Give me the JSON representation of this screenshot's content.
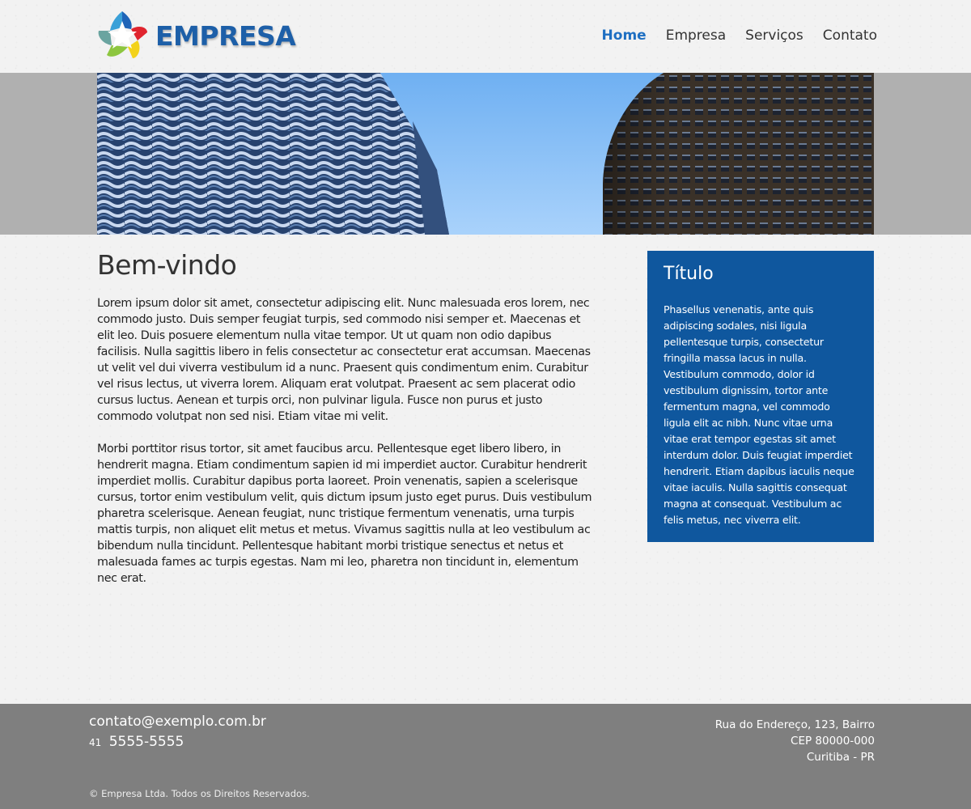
{
  "header": {
    "brand": "EMPRESA",
    "nav": [
      {
        "label": "Home",
        "active": true
      },
      {
        "label": "Empresa",
        "active": false
      },
      {
        "label": "Serviços",
        "active": false
      },
      {
        "label": "Contato",
        "active": false
      }
    ]
  },
  "main": {
    "heading": "Bem-vindo",
    "paragraphs": [
      "Lorem ipsum dolor sit amet, consectetur adipiscing elit. Nunc malesuada eros lorem, nec commodo justo. Duis semper feugiat turpis, sed commodo nisi semper et. Maecenas et elit leo. Duis posuere elementum nulla vitae tempor. Ut ut quam non odio dapibus facilisis. Nulla sagittis libero in felis consectetur ac consectetur erat accumsan. Maecenas ut velit vel dui viverra vestibulum id a nunc. Praesent quis condimentum enim. Curabitur vel risus lectus, ut viverra lorem. Aliquam erat volutpat. Praesent ac sem placerat odio cursus luctus. Aenean et turpis orci, non pulvinar ligula. Fusce non purus et justo commodo volutpat non sed nisi. Etiam vitae mi velit.",
      "Morbi porttitor risus tortor, sit amet faucibus arcu. Pellentesque eget libero libero, in hendrerit magna. Etiam condimentum sapien id mi imperdiet auctor. Curabitur hendrerit imperdiet mollis. Curabitur dapibus porta laoreet. Proin venenatis, sapien a scelerisque cursus, tortor enim vestibulum velit, quis dictum ipsum justo eget purus. Duis vestibulum pharetra scelerisque. Aenean feugiat, nunc tristique fermentum venenatis, urna turpis mattis turpis, non aliquet elit metus et metus. Vivamus sagittis nulla at leo vestibulum ac bibendum nulla tincidunt. Pellentesque habitant morbi tristique senectus et netus et malesuada fames ac turpis egestas. Nam mi leo, pharetra non tincidunt in, elementum nec erat."
    ]
  },
  "sidebar": {
    "title": "Título",
    "text": "Phasellus venenatis, ante quis adipiscing sodales, nisi ligula pellentesque turpis, consectetur fringilla massa lacus in nulla. Vestibulum commodo, dolor id vestibulum dignissim, tortor ante fermentum magna, vel commodo ligula elit ac nibh. Nunc vitae urna vitae erat tempor egestas sit amet interdum dolor. Duis feugiat imperdiet hendrerit. Etiam dapibus iaculis neque vitae iaculis. Nulla sagittis consequat magna at consequat. Vestibulum ac felis metus, nec viverra elit."
  },
  "footer": {
    "email": "contato@exemplo.com.br",
    "phone_ddd": "41",
    "phone": "5555-5555",
    "address": [
      "Rua do Endereço, 123, Bairro",
      "CEP 80000-000",
      "Curitiba - PR"
    ],
    "copyright": "© Empresa Ltda. Todos os Direitos Reservados."
  },
  "colors": {
    "brand_blue": "#1d5fa8",
    "nav_active": "#1e6fc2",
    "sidebar_bg": "#0f579e",
    "footer_bg": "#7f7f7f",
    "banner_band": "#b0b0b0"
  },
  "icons": [
    "star-logo-icon"
  ],
  "banner": {
    "image": "city-buildings-photo"
  }
}
